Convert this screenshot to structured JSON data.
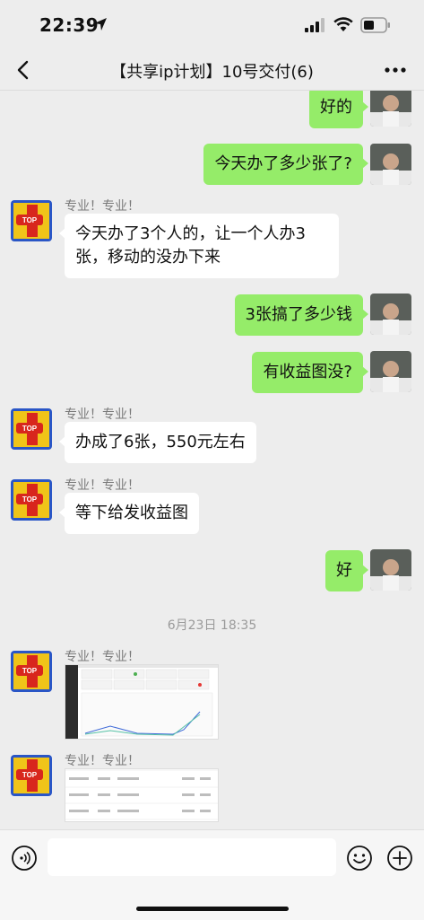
{
  "status": {
    "time": "22:39"
  },
  "header": {
    "title": "【共享ip计划】10号交付(6)"
  },
  "messages": {
    "m1": "好的",
    "m2": "今天办了多少张了?",
    "m3_name": "专业！专业！",
    "m3": "今天办了3个人的，让一个人办3张，移动的没办下来",
    "m4": "3张搞了多少钱",
    "m5": "有收益图没?",
    "m6_name": "专业！专业！",
    "m6": "办成了6张，550元左右",
    "m7_name": "专业！专业！",
    "m7": "等下给发收益图",
    "m8": "好",
    "timestamp": "6月23日 18:35",
    "m9_name": "专业！专业！",
    "m10_name": "专业！专业！"
  },
  "input": {
    "placeholder": ""
  },
  "colors": {
    "background": "#ededed",
    "bubble_self": "#95ec69",
    "bubble_other": "#ffffff"
  },
  "icons": [
    "location-arrow-icon",
    "signal-icon",
    "wifi-icon",
    "battery-icon",
    "back-icon",
    "more-icon",
    "voice-icon",
    "emoji-icon",
    "plus-icon"
  ]
}
